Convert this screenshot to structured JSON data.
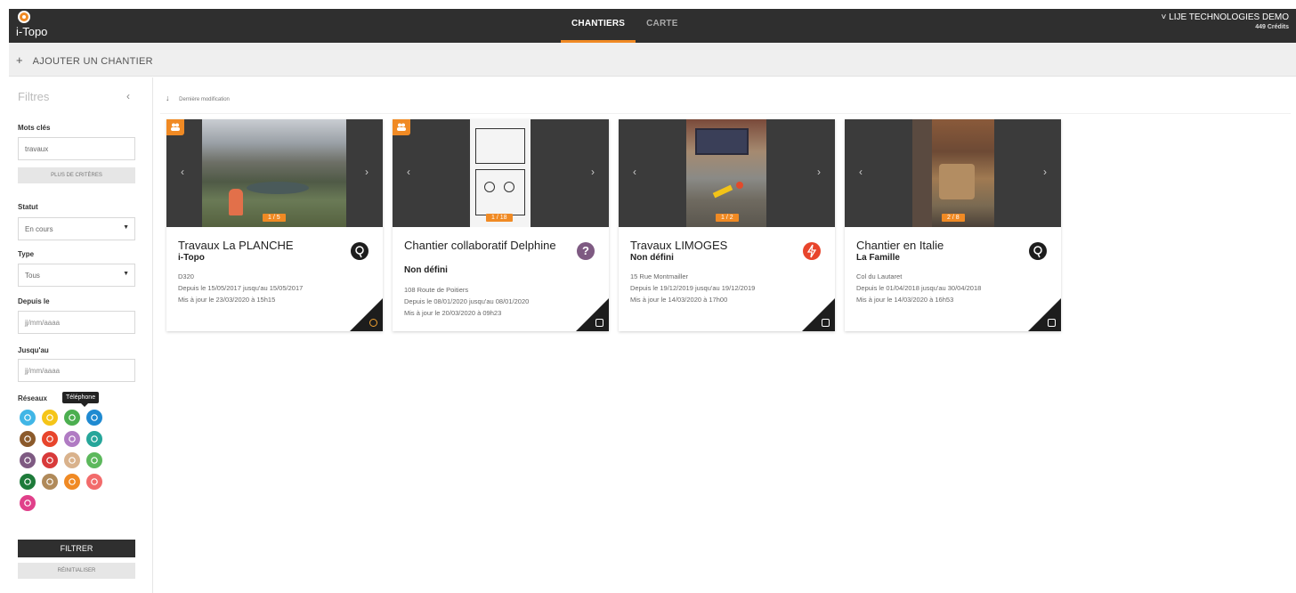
{
  "header": {
    "logo_text": "i-Topo",
    "tabs": [
      {
        "label": "CHANTIERS",
        "active": true
      },
      {
        "label": "CARTE",
        "active": false
      }
    ],
    "account_name": "LIJE TECHNOLOGIES DEMO",
    "account_credits": "449 Crédits",
    "account_chevron": "chevron-down-icon"
  },
  "actionbar": {
    "add_label": "AJOUTER UN CHANTIER",
    "add_icon": "plus-icon"
  },
  "sidebar": {
    "title": "Filtres",
    "collapse_icon": "chevron-left-icon",
    "keywords_label": "Mots clés",
    "keywords_value": "travaux",
    "more_criteria": "PLUS DE CRITÈRES",
    "status_label": "Statut",
    "status_value": "En cours",
    "type_label": "Type",
    "type_value": "Tous",
    "since_label": "Depuis le",
    "since_placeholder": "jj/mm/aaaa",
    "until_label": "Jusqu'au",
    "until_placeholder": "jj/mm/aaaa",
    "networks_label": "Réseaux",
    "tooltip": "Téléphone",
    "networks": [
      {
        "name": "eau-icon",
        "color": "#41b6e6"
      },
      {
        "name": "gaz-icon",
        "color": "#f5c518"
      },
      {
        "name": "telephone-icon",
        "color": "#4caf50"
      },
      {
        "name": "fibre-icon",
        "color": "#1f8ad1"
      },
      {
        "name": "assainissement-icon",
        "color": "#8b5a2b"
      },
      {
        "name": "electricite-icon",
        "color": "#e8452c"
      },
      {
        "name": "chauffage-icon",
        "color": "#b07bc3"
      },
      {
        "name": "eclairage-icon",
        "color": "#26a69a"
      },
      {
        "name": "inconnu-icon",
        "color": "#7e5a82"
      },
      {
        "name": "signalisation-icon",
        "color": "#d83a3a"
      },
      {
        "name": "mobilier-icon",
        "color": "#d9b28c"
      },
      {
        "name": "transport-icon",
        "color": "#5cb85c"
      },
      {
        "name": "arbre-icon",
        "color": "#1e7b3a"
      },
      {
        "name": "urne-icon",
        "color": "#b08a5a"
      },
      {
        "name": "recyclage-icon",
        "color": "#f08a24"
      },
      {
        "name": "ballon-icon",
        "color": "#f26b6b"
      },
      {
        "name": "nuage-icon",
        "color": "#e0408a"
      }
    ],
    "filter_button": "FILTRER",
    "reset_button": "RÉINITIALISER"
  },
  "main": {
    "sort_label": "Dernière modification",
    "sort_icon": "arrow-down-icon",
    "cards": [
      {
        "title": "Travaux La PLANCHE",
        "subtitle": "i-Topo",
        "address": "D320",
        "dates": "Depuis le 15/05/2017  jusqu'au 15/05/2017",
        "updated": "Mis à jour le 23/03/2020 à 15h15",
        "counter": "1 / 5",
        "type_icon": "position-pin-icon",
        "type_color": "#1d1d1d",
        "corner_icon": "photo-icon",
        "group_badge": true
      },
      {
        "title": "Chantier collaboratif Delphine",
        "subtitle": "Non défini",
        "address": "108 Route de Poitiers",
        "dates": "Depuis le 08/01/2020  jusqu'au 08/01/2020",
        "updated": "Mis à jour le 20/03/2020 à 09h23",
        "counter": "1 / 18",
        "type_icon": "question-icon",
        "type_color": "#7e5a82",
        "corner_icon": "square-icon",
        "group_badge": true
      },
      {
        "title": "Travaux LIMOGES",
        "subtitle": "Non défini",
        "address": "15 Rue Montmailler",
        "dates": "Depuis le 19/12/2019  jusqu'au 19/12/2019",
        "updated": "Mis à jour le 14/03/2020 à 17h00",
        "counter": "1 / 2",
        "type_icon": "electricity-icon",
        "type_color": "#e8452c",
        "corner_icon": "square-icon",
        "group_badge": false
      },
      {
        "title": "Chantier en Italie",
        "subtitle": "La Famille",
        "address": "Col du Lautaret",
        "dates": "Depuis le 01/04/2018  jusqu'au 30/04/2018",
        "updated": "Mis à jour le 14/03/2020 à 16h53",
        "counter": "2 / 8",
        "type_icon": "position-pin-icon",
        "type_color": "#1d1d1d",
        "corner_icon": "square-icon",
        "group_badge": false
      }
    ]
  }
}
